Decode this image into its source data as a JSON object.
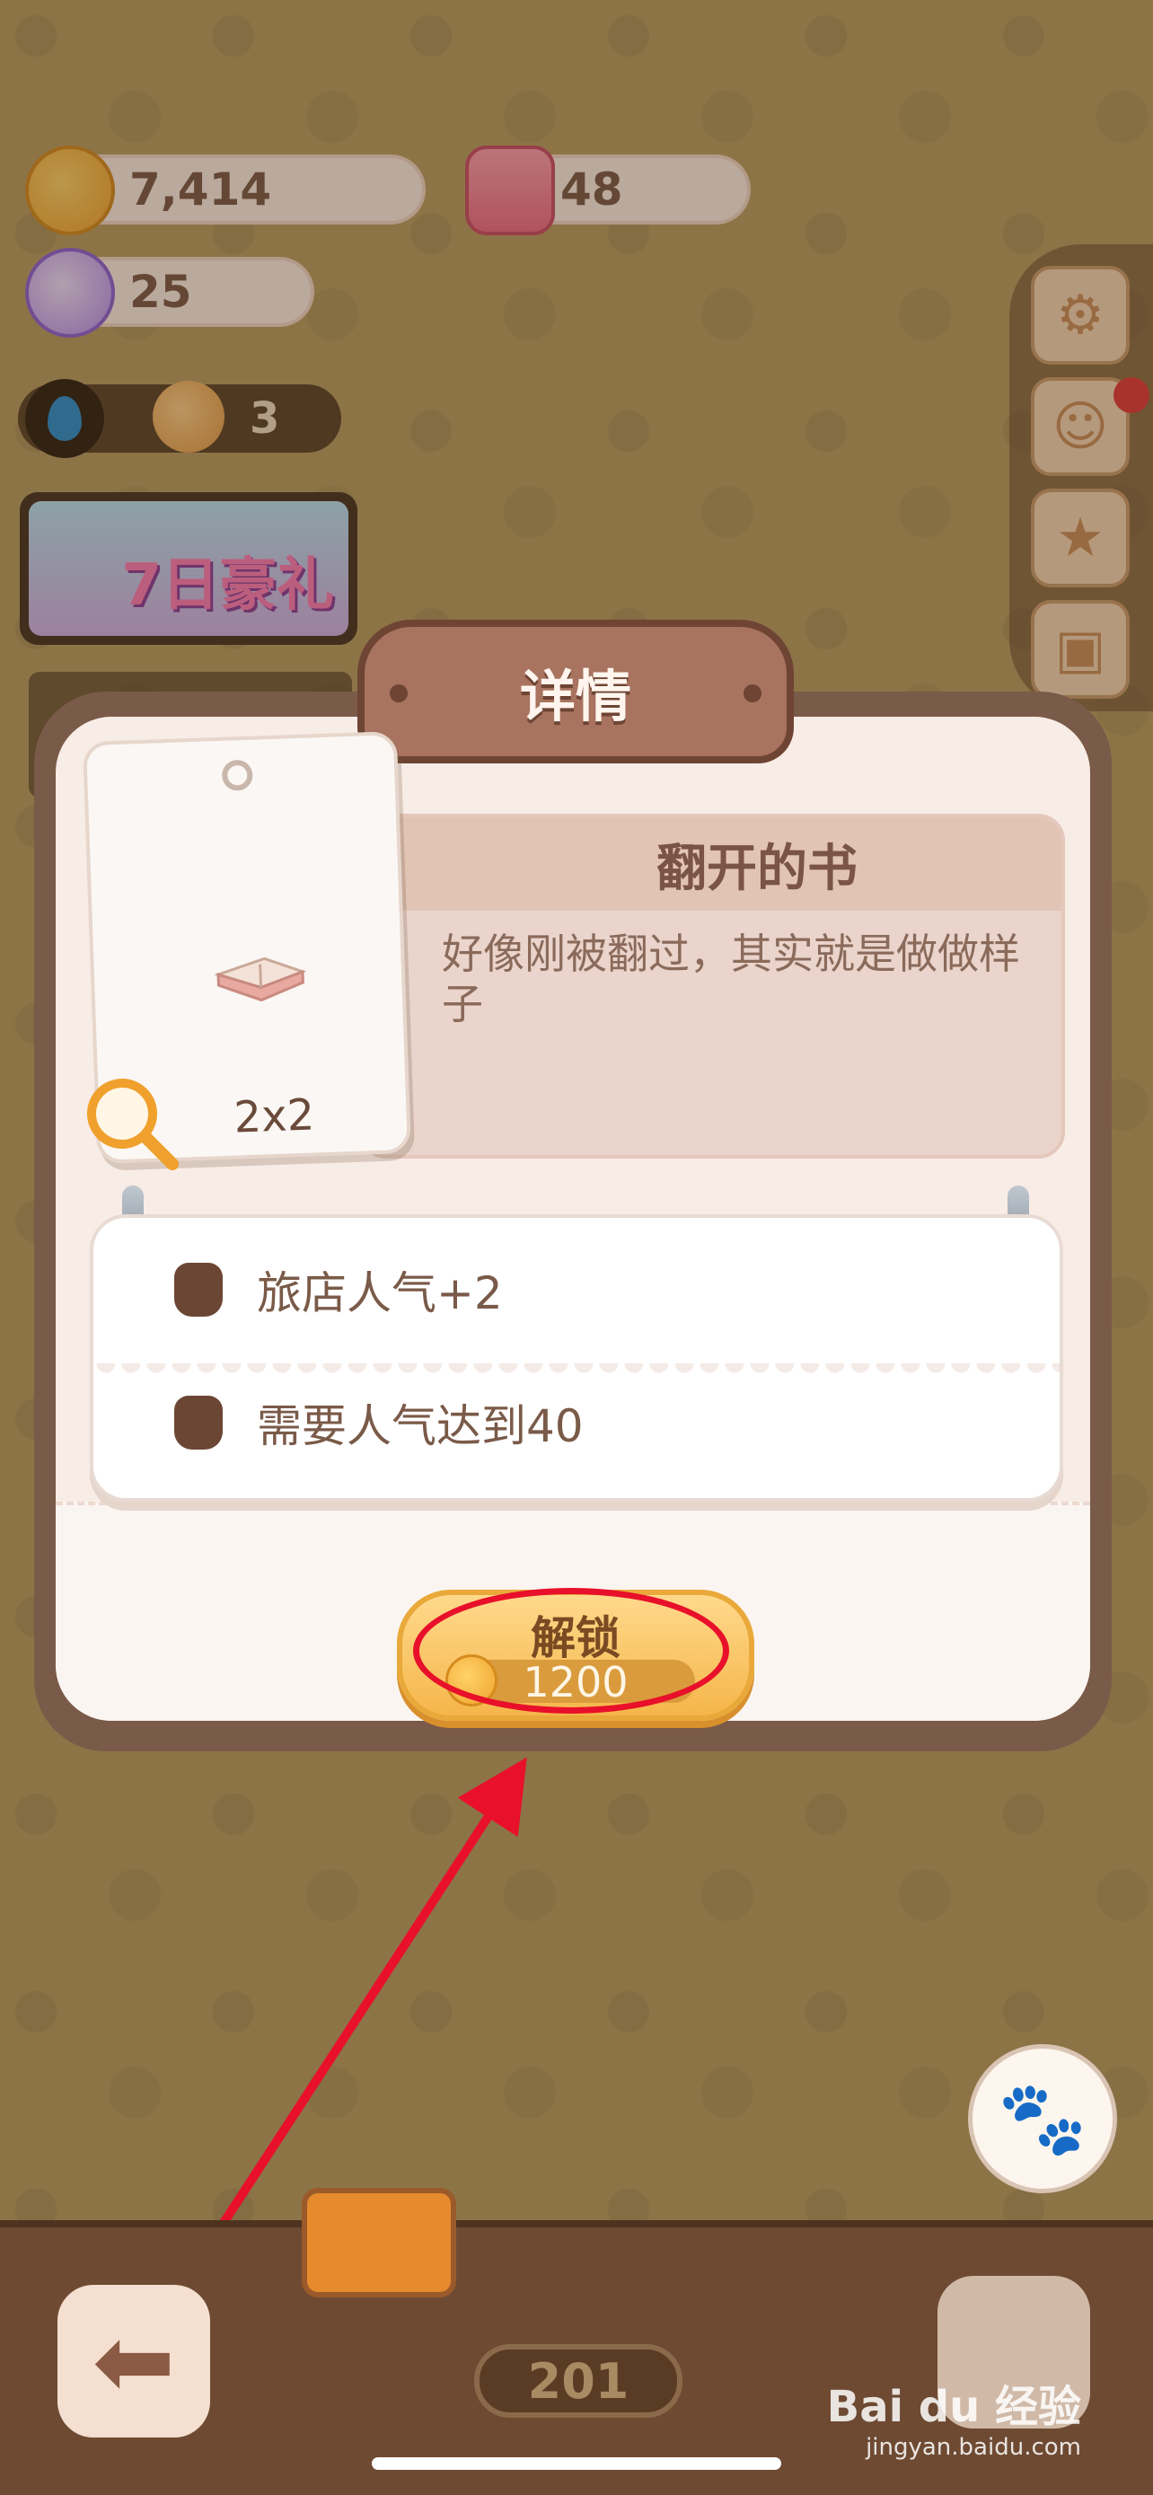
{
  "currencies": {
    "cookies": "7,414",
    "candles": "48",
    "candy": "25"
  },
  "energy": {
    "count": "3"
  },
  "promo": {
    "label": "7日豪礼"
  },
  "dialog": {
    "title": "详情",
    "item_name": "翻开的书",
    "item_description": "好像刚被翻过，其实就是做做样子",
    "item_size": "2x2",
    "effects": [
      {
        "text": "旅店人气+2"
      },
      {
        "text": "需要人气达到40"
      }
    ],
    "unlock": {
      "label": "解锁",
      "price": "1200"
    }
  },
  "bottom": {
    "level": "201"
  },
  "watermark": {
    "brand": "Bai du 经验",
    "url": "jingyan.baidu.com"
  },
  "colors": {
    "annotation_red": "#e8102a",
    "dialog_frame": "#7a5a48",
    "button_gold": "#f5b64a"
  },
  "icons": [
    "cookie-icon",
    "candle-icon",
    "candy-icon",
    "water-drop-icon",
    "face-icon",
    "gear-icon",
    "stamp-icon",
    "star-shop-icon",
    "bag-icon",
    "book-icon",
    "magnifier-icon",
    "popularity-icon",
    "coin-icon",
    "back-arrow-icon",
    "folder-icon",
    "npc-avatar-icon"
  ]
}
